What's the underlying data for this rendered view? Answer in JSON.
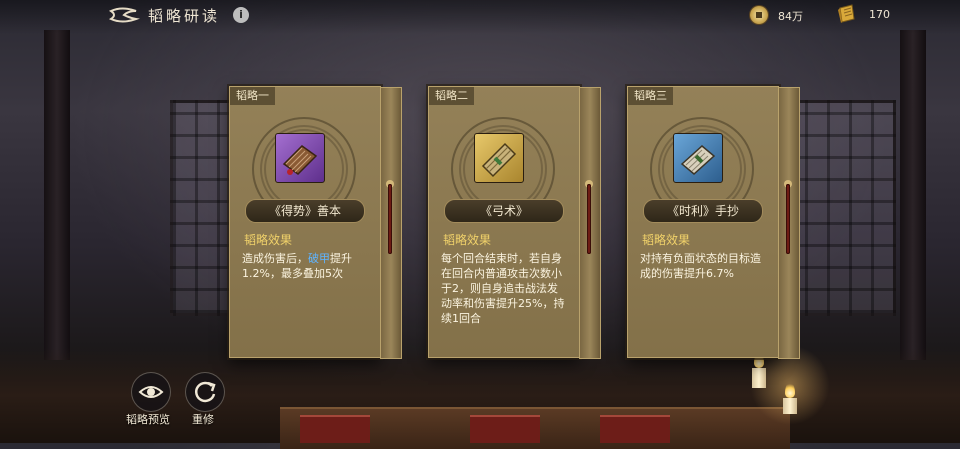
{
  "header": {
    "title": "韬略研读",
    "resources": [
      {
        "icon": "coin-icon",
        "value": "84万"
      },
      {
        "icon": "scroll-icon",
        "value": "170"
      }
    ]
  },
  "cards": [
    {
      "tag": "韬略一",
      "book_name": "《得势》善本",
      "effect_label": "韬略效果",
      "effect_pre": "造成伤害后，",
      "effect_highlight": "破甲",
      "effect_post": "提升1.2%，最多叠加5次",
      "icon": "book-icon"
    },
    {
      "tag": "韬略二",
      "book_name": "《弓术》",
      "effect_label": "韬略效果",
      "effect_text": "每个回合结束时，若自身在回合内普通攻击次数小于2，则自身追击战法发动率和伤害提升25%，持续1回合",
      "icon": "bamboo-scroll-icon"
    },
    {
      "tag": "韬略三",
      "book_name": "《时利》手抄",
      "effect_label": "韬略效果",
      "effect_text": "对持有负面状态的目标造成的伤害提升6.7%",
      "icon": "manuscript-icon"
    }
  ],
  "bottom_buttons": [
    {
      "label": "韬略预览",
      "icon": "eye-icon"
    },
    {
      "label": "重修",
      "icon": "refresh-icon"
    }
  ],
  "colors": {
    "card_bg": "#8e7a4f",
    "effect_label": "#f1d26a",
    "highlight": "#5fb4ff"
  }
}
